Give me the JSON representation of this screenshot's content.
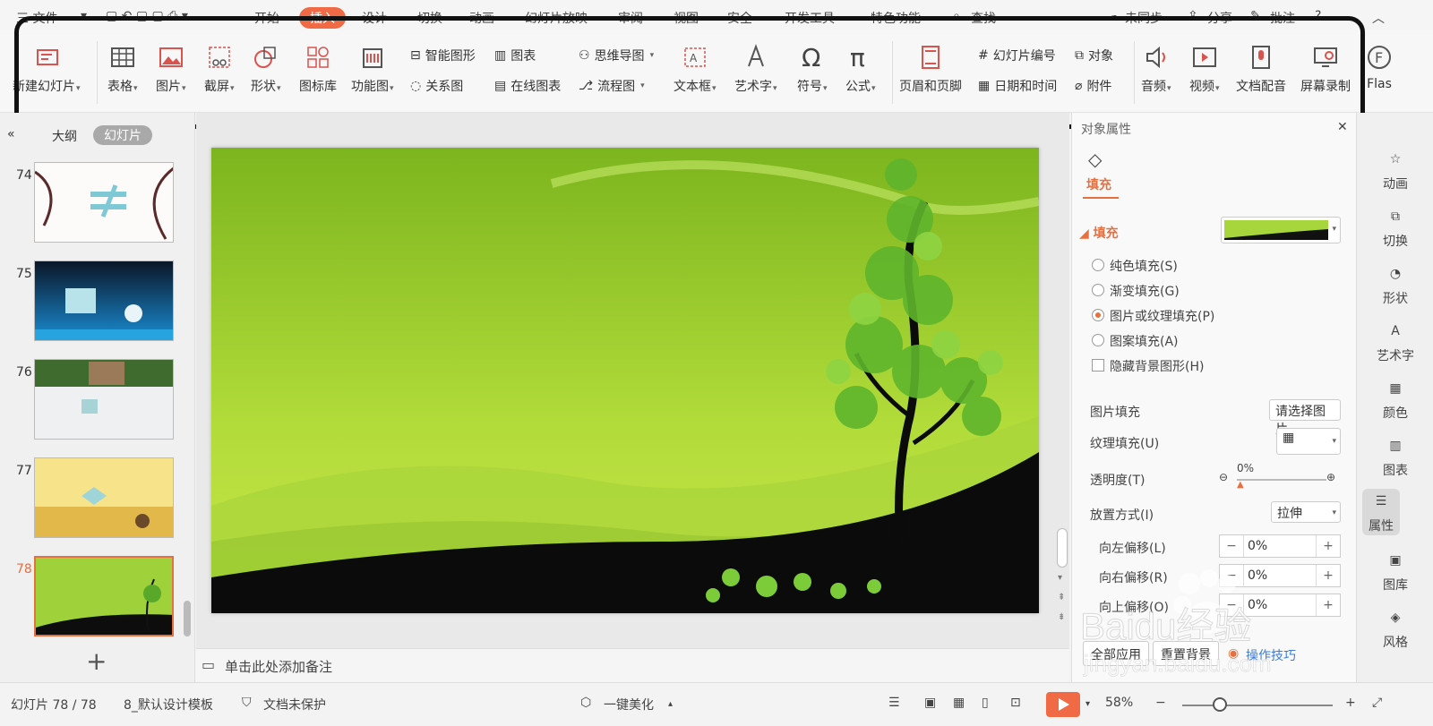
{
  "menu": {
    "file": "三 文件",
    "tabs": [
      "开始",
      "插入",
      "设计",
      "切换",
      "动画",
      "幻灯片放映",
      "审阅",
      "视图",
      "安全",
      "开发工具",
      "特色功能"
    ],
    "active_tab": "插入",
    "search": "查找",
    "sync": "未同步",
    "share": "分享",
    "comment": "批注"
  },
  "ribbon": {
    "new_slide": "新建幻灯片",
    "table": "表格",
    "picture": "图片",
    "screenshot": "截屏",
    "shape": "形状",
    "icon_lib": "图标库",
    "function_chart": "功能图",
    "smart_art": "智能图形",
    "chart": "图表",
    "relation_chart": "关系图",
    "online_chart": "在线图表",
    "mind_map": "思维导图",
    "flow_chart": "流程图",
    "text_box": "文本框",
    "word_art": "艺术字",
    "symbol": "符号",
    "formula": "公式",
    "header_footer": "页眉和页脚",
    "slide_number": "幻灯片编号",
    "object": "对象",
    "date_time": "日期和时间",
    "attachment": "附件",
    "audio": "音频",
    "video": "视频",
    "doc_dubbing": "文档配音",
    "screen_record": "屏幕录制",
    "flash": "Flas"
  },
  "left_panel": {
    "tab_outline": "大纲",
    "tab_slides": "幻灯片",
    "thumbs": [
      "74",
      "75",
      "76",
      "77",
      "78"
    ],
    "selected": "78"
  },
  "notes": {
    "placeholder": "单击此处添加备注"
  },
  "props": {
    "title": "对象属性",
    "tab": "填充",
    "section": "填充",
    "opt_solid": "纯色填充(S)",
    "opt_gradient": "渐变填充(G)",
    "opt_picture": "图片或纹理填充(P)",
    "opt_pattern": "图案填充(A)",
    "opt_hide_bg": "隐藏背景图形(H)",
    "picture_fill_label": "图片填充",
    "picture_fill_value": "请选择图片",
    "texture_fill_label": "纹理填充(U)",
    "transparency_label": "透明度(T)",
    "transparency_value": "0%",
    "placement_label": "放置方式(I)",
    "placement_value": "拉伸",
    "offset_left_label": "向左偏移(L)",
    "offset_left_value": "0%",
    "offset_right_label": "向右偏移(R)",
    "offset_right_value": "0%",
    "offset_up_label": "向上偏移(O)",
    "offset_up_value": "0%",
    "apply_all": "全部应用",
    "reset_bg": "重置背景",
    "tips": "操作技巧"
  },
  "sidebar": {
    "items": [
      "动画",
      "切换",
      "形状",
      "艺术字",
      "颜色",
      "图表",
      "属性",
      "图库",
      "风格"
    ],
    "active": "属性"
  },
  "status": {
    "slide_count": "幻灯片 78 / 78",
    "template": "8_默认设计模板",
    "protection": "文档未保护",
    "beautify": "一键美化",
    "zoom": "58%"
  },
  "watermark": {
    "brand": "Baidu经验",
    "url": "jingyan.baidu.com"
  },
  "colors": {
    "accent": "#f06a45",
    "highlight_border": "#111111",
    "slide_green": "#a6d63b"
  }
}
